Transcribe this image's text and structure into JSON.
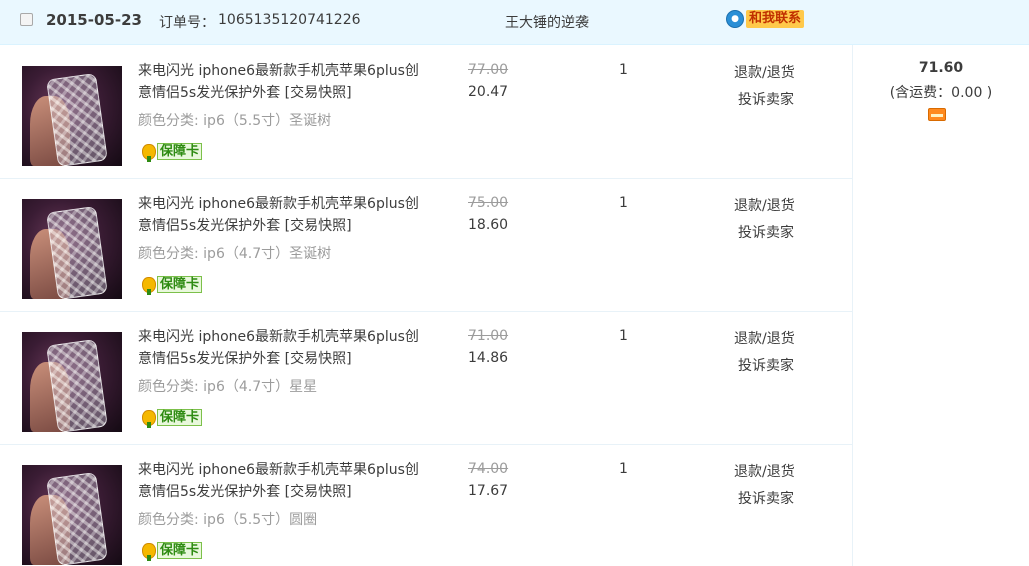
{
  "order": {
    "date": "2015-05-23",
    "order_no_label": "订单号：",
    "order_no": "1065135120741226",
    "seller": "王大锤的逆袭",
    "contact_label": "和我联系",
    "contact_icon": "chat-bubble-icon"
  },
  "items": [
    {
      "title": "来电闪光 iphone6最新款手机壳苹果6plus创意情侣5s发光保护外套 [交易快照]",
      "spec": "颜色分类: ip6（5.5寸）圣诞树",
      "badge": "保障卡",
      "original_price": "77.00",
      "price": "20.47",
      "qty": "1",
      "refund": "退款/退货",
      "complain": "投诉卖家"
    },
    {
      "title": "来电闪光 iphone6最新款手机壳苹果6plus创意情侣5s发光保护外套 [交易快照]",
      "spec": "颜色分类: ip6（4.7寸）圣诞树",
      "badge": "保障卡",
      "original_price": "75.00",
      "price": "18.60",
      "qty": "1",
      "refund": "退款/退货",
      "complain": "投诉卖家"
    },
    {
      "title": "来电闪光 iphone6最新款手机壳苹果6plus创意情侣5s发光保护外套 [交易快照]",
      "spec": "颜色分类: ip6（4.7寸）星星",
      "badge": "保障卡",
      "original_price": "71.00",
      "price": "14.86",
      "qty": "1",
      "refund": "退款/退货",
      "complain": "投诉卖家"
    },
    {
      "title": "来电闪光 iphone6最新款手机壳苹果6plus创意情侣5s发光保护外套 [交易快照]",
      "spec": "颜色分类: ip6（5.5寸）圆圈",
      "badge": "保障卡",
      "original_price": "74.00",
      "price": "17.67",
      "qty": "1",
      "refund": "退款/退货",
      "complain": "投诉卖家"
    }
  ],
  "summary": {
    "total": "71.60",
    "shipping": "(含运费：0.00 )",
    "payment_icon": "card-icon"
  },
  "colors": {
    "header_bg": "#eaf8ff",
    "contact_bg": "#ffc94a",
    "badge_green": "#2e8b12",
    "text": "#3c3c3c",
    "muted": "#9c9c9c"
  }
}
